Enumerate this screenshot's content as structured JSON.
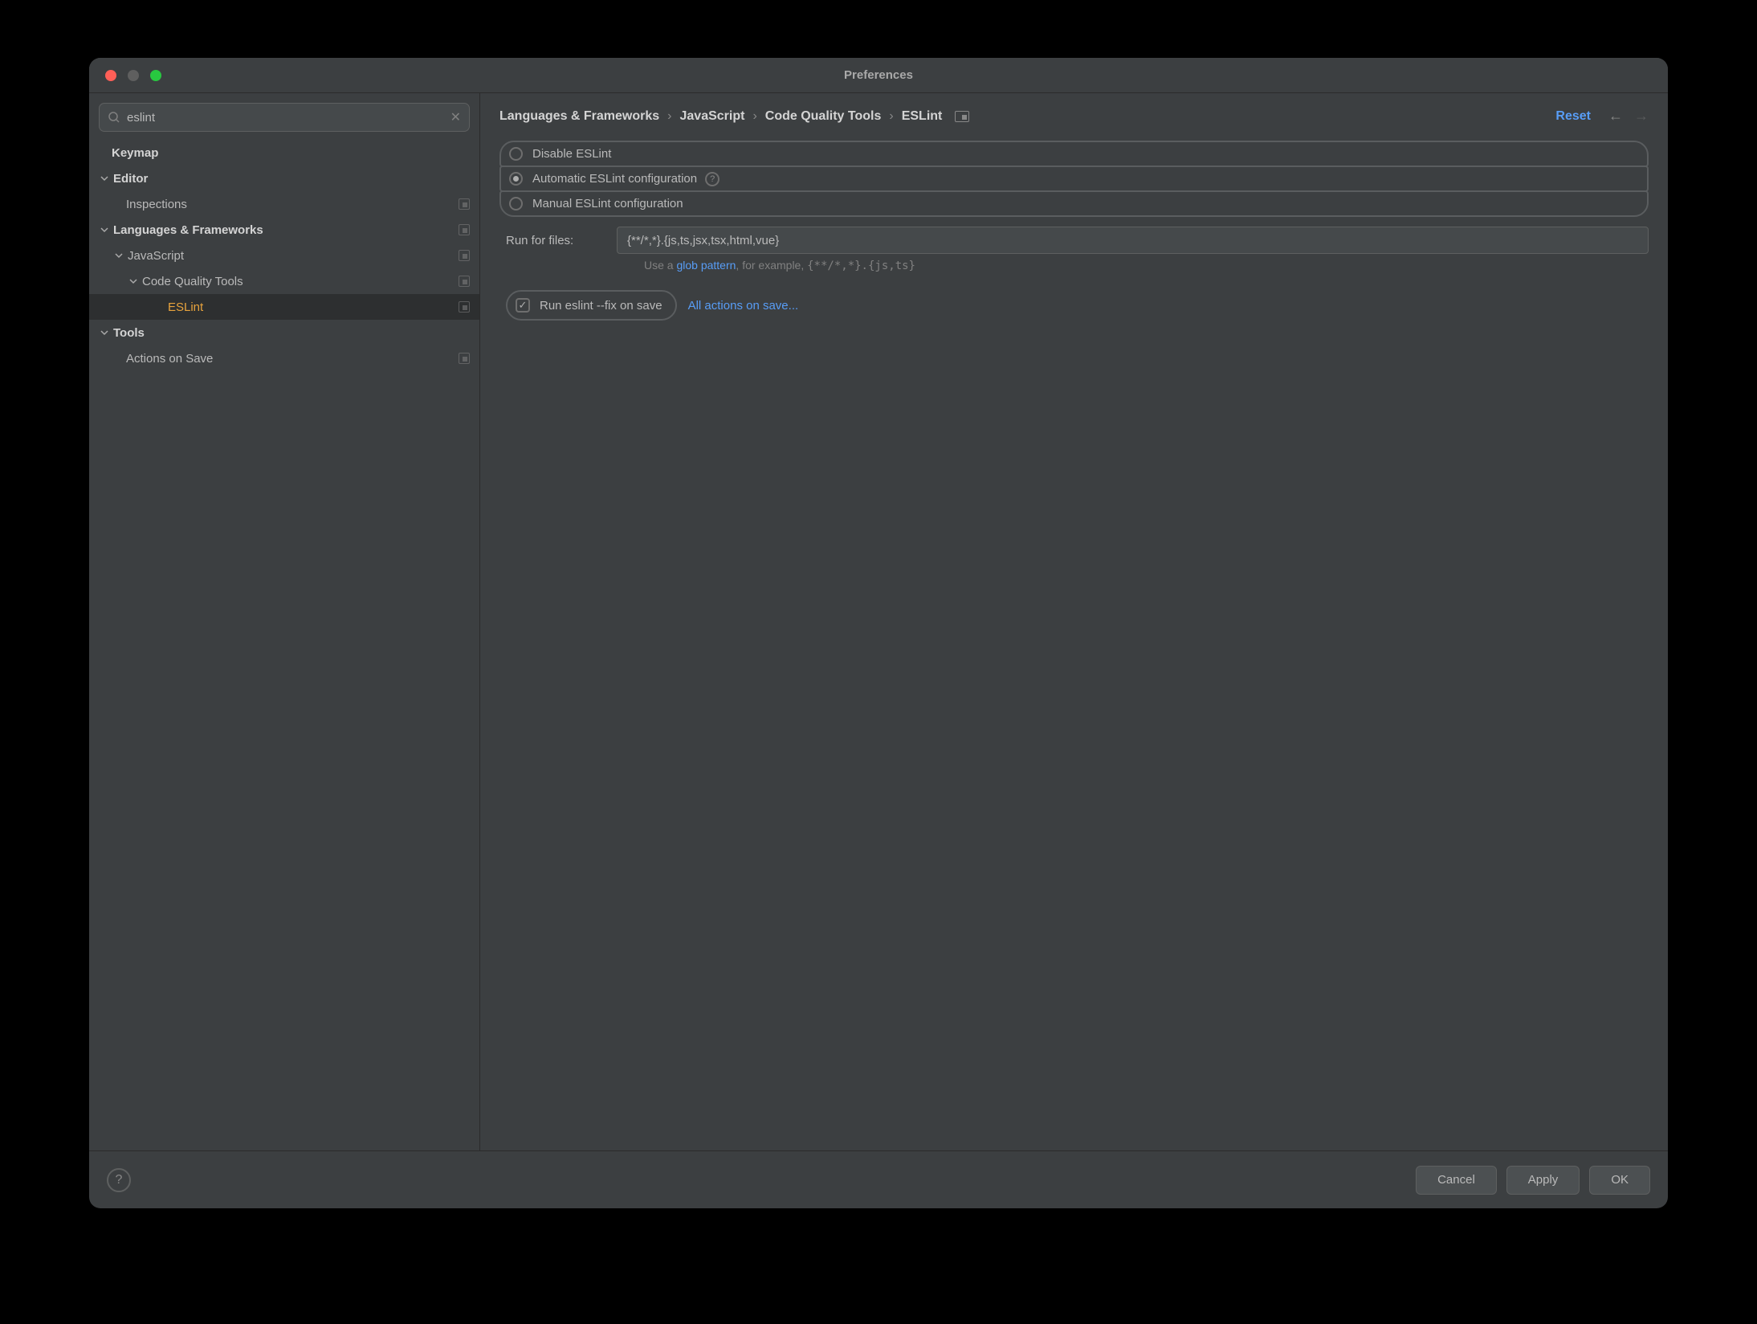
{
  "window": {
    "title": "Preferences"
  },
  "search": {
    "value": "eslint"
  },
  "tree": {
    "keymap": "Keymap",
    "editor": "Editor",
    "inspections": "Inspections",
    "langfw": "Languages & Frameworks",
    "javascript": "JavaScript",
    "cqt": "Code Quality Tools",
    "eslint": "ESLint",
    "tools": "Tools",
    "actions_on_save": "Actions on Save"
  },
  "breadcrumb": {
    "b0": "Languages & Frameworks",
    "b1": "JavaScript",
    "b2": "Code Quality Tools",
    "b3": "ESLint"
  },
  "header": {
    "reset": "Reset"
  },
  "radios": {
    "disable": "Disable ESLint",
    "auto": "Automatic ESLint configuration",
    "manual": "Manual ESLint configuration"
  },
  "run_for": {
    "label": "Run for files:",
    "value": "{**/*,*}.{js,ts,jsx,tsx,html,vue}",
    "hint_prefix": "Use a ",
    "hint_link": "glob pattern",
    "hint_mid": ", for example, ",
    "hint_example": "{**/*,*}.{js,ts}"
  },
  "fix": {
    "label": "Run eslint --fix on save",
    "link": "All actions on save..."
  },
  "footer": {
    "cancel": "Cancel",
    "apply": "Apply",
    "ok": "OK"
  }
}
